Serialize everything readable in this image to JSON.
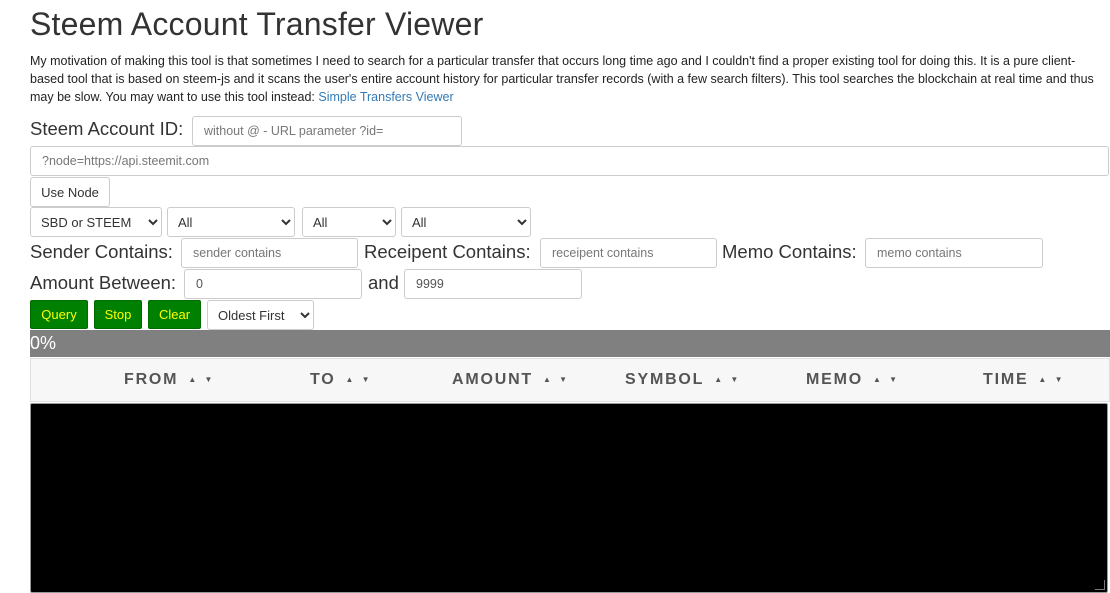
{
  "page": {
    "title": "Steem Account Transfer Viewer",
    "intro_text": "My motivation of making this tool is that sometimes I need to search for a particular transfer that occurs long time ago and I couldn't find a proper existing tool for doing this. It is a pure client-based tool that is based on steem-js and it scans the user's entire account history for particular transfer records (with a few search filters). This tool searches the blockchain at real time and thus may be slow. You may want to use this tool instead: ",
    "intro_link": "Simple Transfers Viewer"
  },
  "account": {
    "label": "Steem Account ID:",
    "placeholder": "without @ - URL parameter ?id="
  },
  "node": {
    "placeholder": "?node=https://api.steemit.com",
    "button_label": "Use Node"
  },
  "filters": {
    "currency_selected": "SBD or STEEM",
    "filter2_selected": "All",
    "filter3_selected": "All",
    "filter4_selected": "All",
    "sender_label": "Sender Contains:",
    "sender_placeholder": "sender contains",
    "recipient_label": "Receipent Contains:",
    "recipient_placeholder": "receipent contains",
    "memo_label": "Memo Contains:",
    "memo_placeholder": "memo contains",
    "amount_label": "Amount Between:",
    "amount_min": "0",
    "amount_and": "and",
    "amount_max": "9999"
  },
  "actions": {
    "query": "Query",
    "stop": "Stop",
    "clear": "Clear",
    "order_selected": "Oldest First"
  },
  "progress": {
    "value": 0,
    "text": "0%"
  },
  "table": {
    "columns": [
      "FROM",
      "TO",
      "AMOUNT",
      "SYMBOL",
      "MEMO",
      "TIME"
    ],
    "sort_icon": "▲ ▼"
  },
  "colors": {
    "accent_link": "#337ab7",
    "button_green": "#008000",
    "button_text": "#ffff00",
    "progress_bg": "#808080",
    "results_bg": "#000000"
  }
}
